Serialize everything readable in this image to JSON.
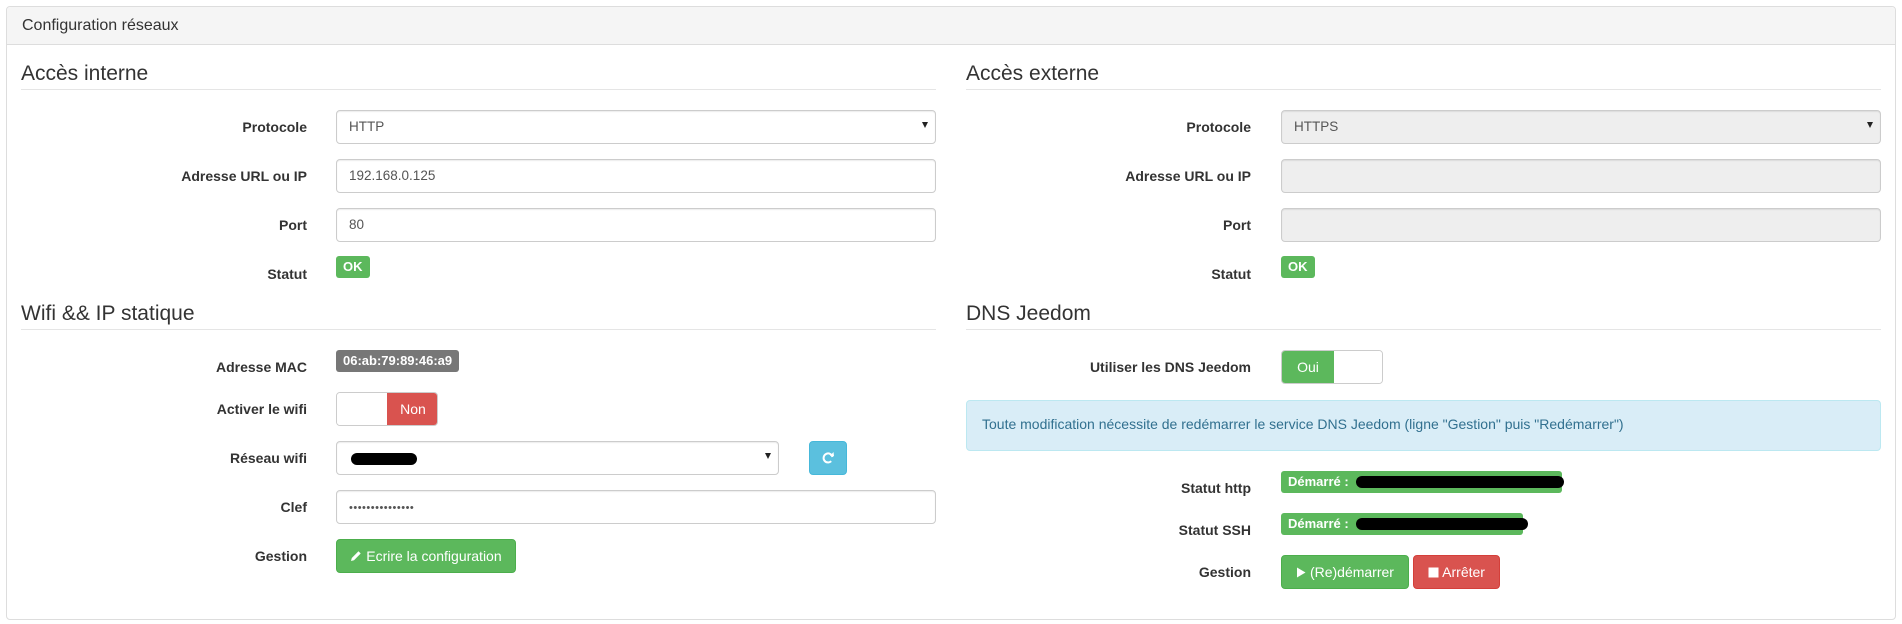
{
  "panel": {
    "title": "Configuration réseaux"
  },
  "internal": {
    "legend": "Accès interne",
    "protocol_label": "Protocole",
    "protocol_value": "HTTP",
    "address_label": "Adresse URL ou IP",
    "address_value": "192.168.0.125",
    "port_label": "Port",
    "port_value": "80",
    "status_label": "Statut",
    "status_value": "OK"
  },
  "external": {
    "legend": "Accès externe",
    "protocol_label": "Protocole",
    "protocol_value": "HTTPS",
    "address_label": "Adresse URL ou IP",
    "address_value": "",
    "port_label": "Port",
    "port_value": "",
    "status_label": "Statut",
    "status_value": "OK"
  },
  "wifi": {
    "legend": "Wifi && IP statique",
    "mac_label": "Adresse MAC",
    "mac_value": "06:ab:79:89:46:a9",
    "enable_label": "Activer le wifi",
    "enable_value": "Non",
    "network_label": "Réseau wifi",
    "key_label": "Clef",
    "key_value": "•••••••••••••••",
    "manage_label": "Gestion",
    "write_button": "Ecrire la configuration"
  },
  "dns": {
    "legend": "DNS Jeedom",
    "use_label": "Utiliser les DNS Jeedom",
    "use_value": "Oui",
    "alert": "Toute modification nécessite de redémarrer le service DNS Jeedom (ligne \"Gestion\" puis \"Redémarrer\")",
    "http_label": "Statut http",
    "http_value": "Démarré :",
    "ssh_label": "Statut SSH",
    "ssh_value": "Démarré :",
    "manage_label": "Gestion",
    "restart_button": "(Re)démarrer",
    "stop_button": "Arrêter"
  },
  "icons": {
    "refresh": "refresh-icon",
    "pencil": "pencil-icon",
    "play": "play-icon",
    "stop": "stop-icon"
  }
}
